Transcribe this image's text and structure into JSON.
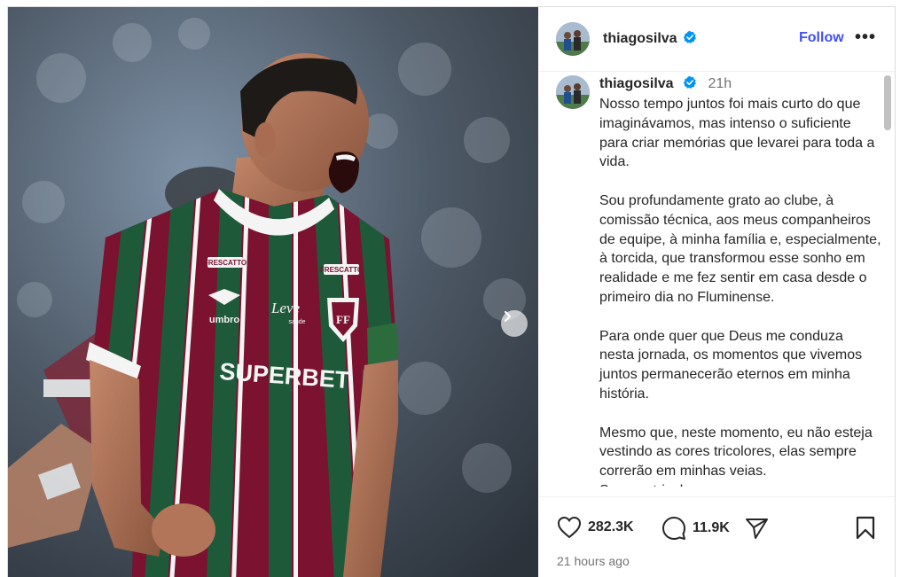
{
  "post": {
    "username": "thiagosilva",
    "follow_label": "Follow",
    "more_label": "•••",
    "caption_time": "21h",
    "caption": "Nosso tempo juntos foi mais curto do que imaginávamos, mas intenso o suficiente para criar memórias que levarei para toda a vida.\n\nSou profundamente grato ao clube, à comissão técnica, aos meus companheiros de equipe, à minha família e, especialmente, à torcida, que transformou esse sonho em realidade e me fez sentir em casa desde o primeiro dia no Fluminense.\n\nPara onde quer que Deus me conduza nesta jornada, os momentos que vivemos juntos permanecerão eternos em minha história.\n\nMesmo que, neste momento, eu não esteja vestindo as cores tricolores, elas sempre correrão em minhas veias.\nSempre tricolor.",
    "likes": "282.3K",
    "comments": "11.9K",
    "time_ago": "21 hours ago"
  },
  "media": {
    "jersey_text": "SUPERBET",
    "umbro_text": "umbro",
    "sponsor_text": "Leve",
    "sponsor_sub": "saúde",
    "patch_text": "FRESCATTO"
  },
  "icons": {
    "verified": "verified-badge-icon",
    "next": "chevron-right-icon",
    "like": "heart-icon",
    "comment": "comment-bubble-icon",
    "share": "send-paper-plane-icon",
    "save": "bookmark-icon"
  },
  "colors": {
    "follow_blue": "#4150f7",
    "verified_blue": "#0095f6",
    "jersey_maroon": "#7a1230",
    "jersey_green": "#1e5a3a"
  }
}
